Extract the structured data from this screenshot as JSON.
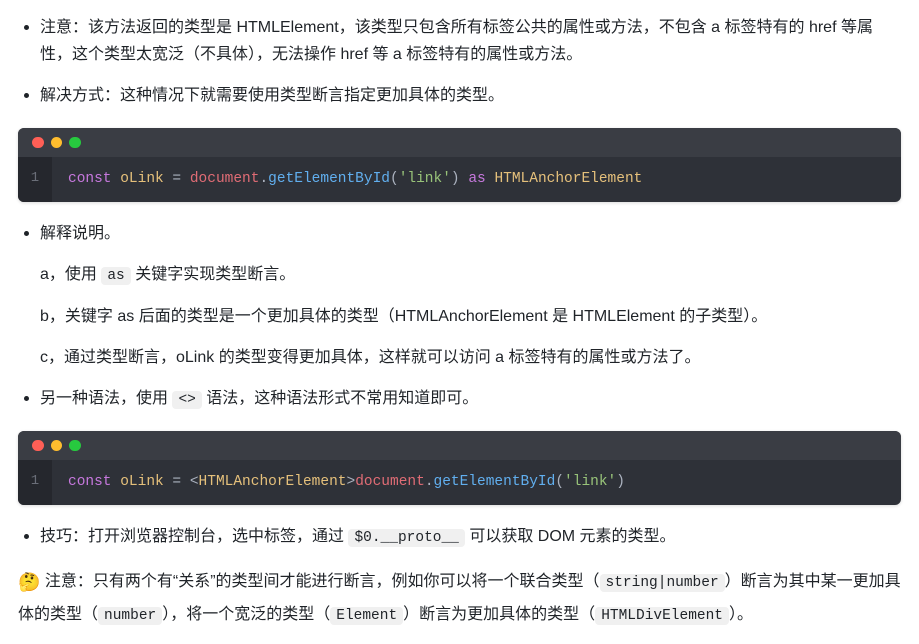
{
  "bullets": {
    "b1": {
      "prefix": "注意：该方法返回的类型是 ",
      "code1": "HTMLElement",
      "mid1": "，该类型只包含所有标签公共的属性或方法，不包含 a 标签特有的 href 等属性，这个类型太宽泛（不具体），无法操作 href 等 a 标签特有的属性或方法。"
    },
    "b2": "解决方式：这种情况下就需要使用类型断言指定更加具体的类型。",
    "b3": "解释说明。",
    "b3a_p1": "a，使用 ",
    "b3a_code": "as",
    "b3a_p2": " 关键字实现类型断言。",
    "b3b": "b，关键字 as 后面的类型是一个更加具体的类型（HTMLAnchorElement 是 HTMLElement 的子类型）。",
    "b3c": "c，通过类型断言，oLink 的类型变得更加具体，这样就可以访问 a 标签特有的属性或方法了。",
    "b4_p1": "另一种语法，使用 ",
    "b4_code": "<>",
    "b4_p2": " 语法，这种语法形式不常用知道即可。",
    "b5_p1": "技巧：打开浏览器控制台，选中标签，通过 ",
    "b5_code": "$0.__proto__",
    "b5_p2": " 可以获取 DOM 元素的类型。"
  },
  "code1": {
    "ln": "1",
    "const": "const",
    "name": "oLink",
    "eq": " = ",
    "doc": "document",
    "dot": ".",
    "fn": "getElementById",
    "lp": "(",
    "str": "'link'",
    "rp": ")",
    "as": " as ",
    "type": "HTMLAnchorElement"
  },
  "code2": {
    "ln": "1",
    "const": "const",
    "name": "oLink",
    "eq": " = ",
    "lt": "<",
    "type": "HTMLAnchorElement",
    "gt": ">",
    "doc": "document",
    "dot": ".",
    "fn": "getElementById",
    "lp": "(",
    "str": "'link'",
    "rp": ")"
  },
  "note": {
    "emoji": "🤔",
    "p1": " 注意：只有两个有“关系”的类型间才能进行断言，例如你可以将一个联合类型（",
    "c1": "string|number",
    "p2": "）断言为其中某一更加具体的类型（",
    "c2": "number",
    "p3": "），将一个宽泛的类型（",
    "c3": "Element",
    "p4": "）断言为更加具体的类型（",
    "c4": "HTMLDivElement",
    "p5": "）。"
  }
}
